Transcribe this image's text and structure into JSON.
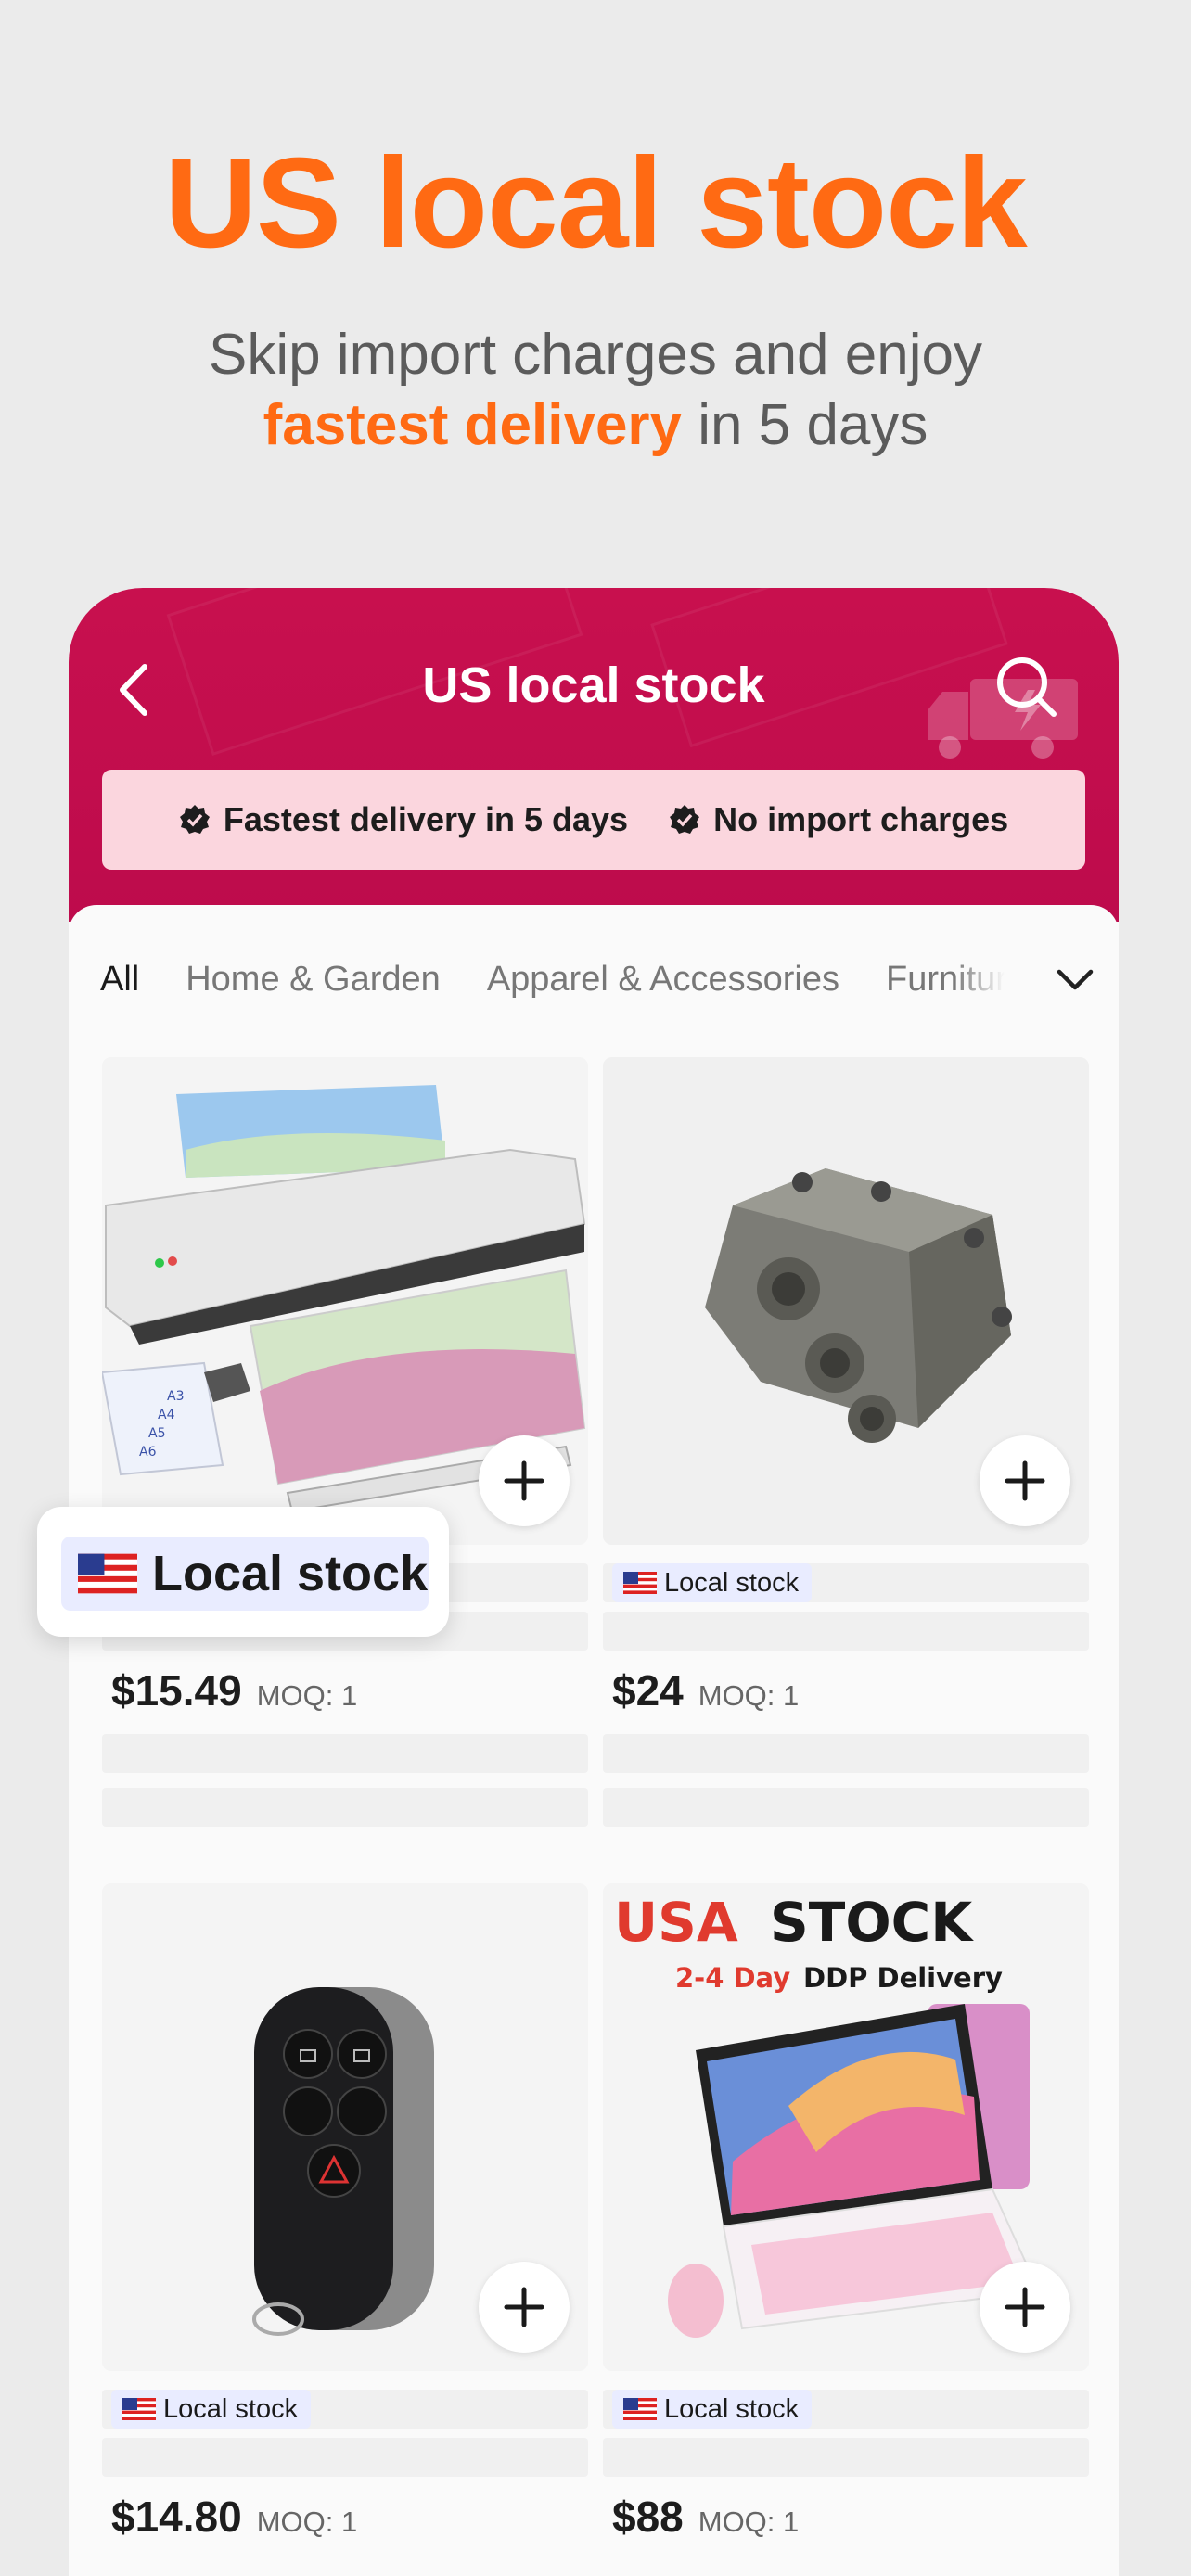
{
  "hero": {
    "title": "US local stock",
    "subtitle_line1": "Skip import charges and enjoy",
    "subtitle_highlight": "fastest delivery",
    "subtitle_rest": " in 5 days"
  },
  "header": {
    "title": "US local stock",
    "benefits": [
      "Fastest delivery in 5 days",
      "No import charges"
    ]
  },
  "tabs": [
    "All",
    "Home & Garden",
    "Apparel & Accessories",
    "Furniture"
  ],
  "callout": {
    "label": "Local stock"
  },
  "products": [
    {
      "badge": "",
      "price": "$15.49",
      "moq": "MOQ: 1",
      "image": "laminator"
    },
    {
      "badge": "Local stock",
      "price": "$24",
      "moq": "MOQ: 1",
      "image": "valve-part"
    },
    {
      "badge": "Local stock",
      "price": "$14.80",
      "moq": "MOQ: 1",
      "image": "car-key-fob"
    },
    {
      "badge": "Local stock",
      "price": "$88",
      "moq": "MOQ: 1",
      "image": "tablet-keyboard"
    }
  ],
  "promo_image": {
    "line1a": "USA",
    "line1b": "STOCK",
    "line2a": "2-4 Day",
    "line2b": "DDP Delivery"
  },
  "colors": {
    "accent": "#ff6a13",
    "header": "#c8104e",
    "badge_bg": "#e9ecff"
  }
}
